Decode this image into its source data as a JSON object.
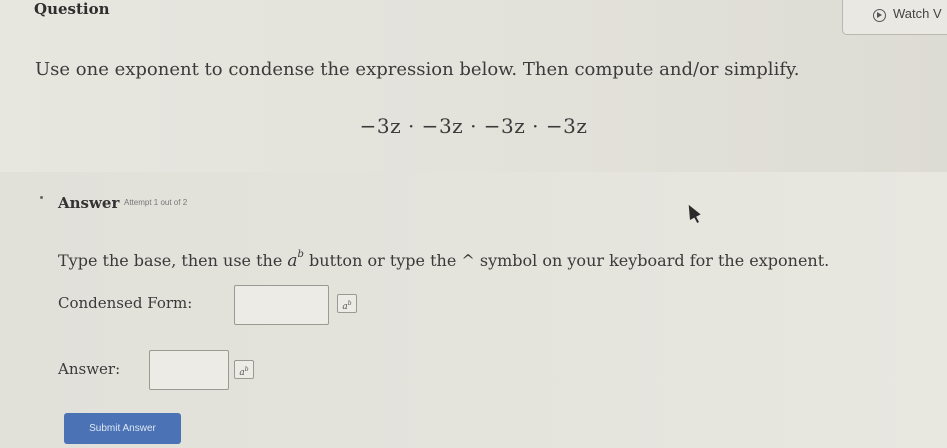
{
  "question": {
    "label": "Question",
    "watch_label": "Watch V",
    "instruction": "Use one exponent to condense the expression below. Then compute and/or simplify.",
    "expression": "−3z · −3z · −3z · −3z"
  },
  "answer": {
    "heading": "Answer",
    "attempt_text": "Attempt 1 out of 2",
    "type_instruction_before": "Type the base, then use the ",
    "exp_button_base": "a",
    "exp_button_power": "b",
    "type_instruction_after": " button or type the ^ symbol on your keyboard for the exponent.",
    "condensed_label": "Condensed Form:",
    "condensed_value": "",
    "answer_label": "Answer:",
    "answer_value": "",
    "submit_label": "Submit Answer"
  },
  "colors": {
    "background": "#e4e3dc",
    "submit_button": "#4a72b5"
  }
}
